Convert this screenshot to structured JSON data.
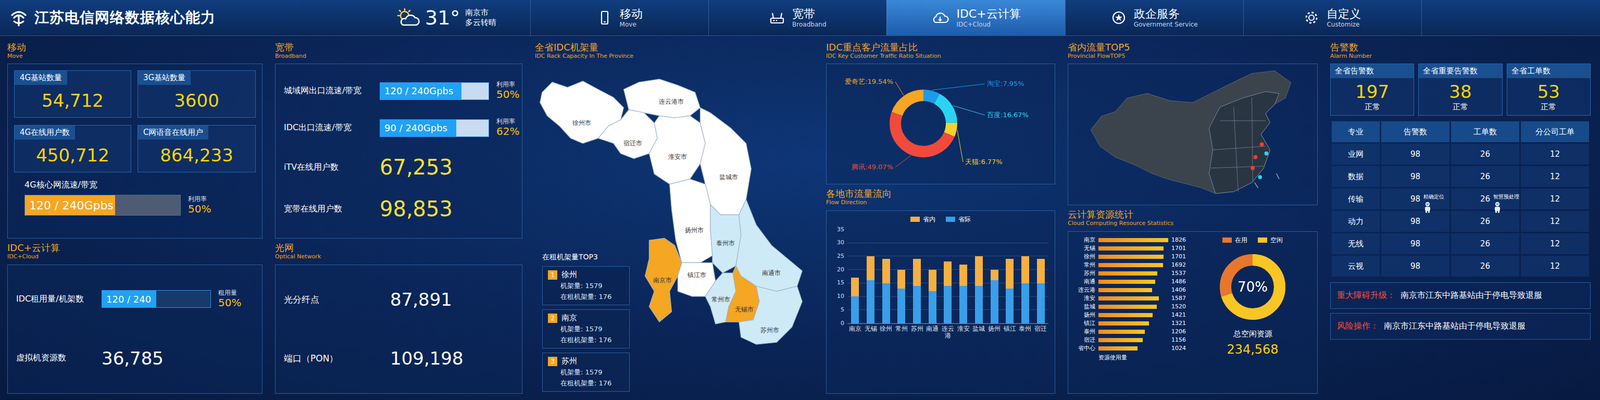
{
  "header": {
    "title": "江苏电信网络数据核心能力",
    "weather": {
      "temp": "31°",
      "city": "南京市",
      "desc": "多云转晴"
    }
  },
  "tabs": [
    {
      "label": "移动",
      "sub": "Move",
      "kind": "mobile",
      "selected": false
    },
    {
      "label": "宽带",
      "sub": "Broadband",
      "kind": "router",
      "selected": false
    },
    {
      "label": "IDC+云计算",
      "sub": "IDC+Cloud",
      "kind": "cloud",
      "selected": true
    },
    {
      "label": "政企服务",
      "sub": "Government Service",
      "kind": "badge",
      "selected": false
    },
    {
      "label": "自定义",
      "sub": "Customize",
      "kind": "gear",
      "selected": false
    }
  ],
  "mobile": {
    "title": "移动",
    "subtitle": "Move",
    "stats": [
      {
        "label": "4G基站数量",
        "value": "54,712"
      },
      {
        "label": "3G基站数量",
        "value": "3600"
      },
      {
        "label": "4G在线用户数",
        "value": "450,712"
      },
      {
        "label": "C网语音在线用户",
        "value": "864,233"
      }
    ],
    "bandwidth": {
      "label": "4G核心网流速/带宽",
      "reading": "120 / 240Gpbs",
      "level": 0.58,
      "rate_label": "利用率",
      "rate": "50%"
    }
  },
  "idc": {
    "title": "IDC+云计算",
    "subtitle": "IDC+Cloud",
    "usage": {
      "label": "IDC租用量/机架数",
      "reading": "120 / 240",
      "level": 0.5,
      "rate_label": "租用量",
      "rate": "50%"
    },
    "vm": {
      "label": "虚拟机资源数",
      "value": "36,785"
    }
  },
  "broadband": {
    "title": "宽带",
    "subtitle": "Broadband",
    "bars": [
      {
        "label": "城域网出口流速/带宽",
        "reading": "120 / 240Gpbs",
        "level": 0.75,
        "rate_label": "利用率",
        "rate": "50%"
      },
      {
        "label": "IDC出口流速/带宽",
        "reading": "90 / 240Gpbs",
        "level": 0.7,
        "rate_label": "利用率",
        "rate": "62%"
      }
    ],
    "stats": [
      {
        "label": "iTV在线用户数",
        "value": "67,253"
      },
      {
        "label": "宽带在线用户数",
        "value": "98,853"
      }
    ]
  },
  "optical": {
    "title": "光网",
    "subtitle": "Optical Network",
    "stats": [
      {
        "label": "光分纤点",
        "value": "87,891"
      },
      {
        "label": "端口（PON）",
        "value": "109,198"
      }
    ]
  },
  "rack": {
    "title": "全省IDC机架量",
    "subtitle": "IDC Rack Capacity In The Province",
    "cities": [
      {
        "name": "徐州市",
        "color": "#ffffff"
      },
      {
        "name": "连云港市",
        "color": "#ffffff"
      },
      {
        "name": "宿迁市",
        "color": "#ffffff"
      },
      {
        "name": "淮安市",
        "color": "#ffffff"
      },
      {
        "name": "盐城市",
        "color": "#ffffff"
      },
      {
        "name": "扬州市",
        "color": "#ffffff"
      },
      {
        "name": "泰州市",
        "color": "#cfeaf7"
      },
      {
        "name": "南通市",
        "color": "#cfeaf7"
      },
      {
        "name": "南京市",
        "color": "#f5a623"
      },
      {
        "name": "镇江市",
        "color": "#ffffff"
      },
      {
        "name": "常州市",
        "color": "#cfeaf7"
      },
      {
        "name": "无锡市",
        "color": "#f5a623"
      },
      {
        "name": "苏州市",
        "color": "#cfeaf7"
      }
    ],
    "top3": {
      "title": "在租机架量TOP3",
      "items": [
        {
          "rank": "1",
          "city": "徐州",
          "racks": "机架量: 1579",
          "rented": "在租机架量: 176"
        },
        {
          "rank": "2",
          "city": "南京",
          "racks": "机架量: 1579",
          "rented": "在租机架量: 176"
        },
        {
          "rank": "3",
          "city": "苏州",
          "racks": "机架量: 1579",
          "rented": "在租机架量: 176"
        }
      ]
    }
  },
  "customers": {
    "title": "IDC重点客户流量占比",
    "subtitle": "IDC Key Customer Traffic Ratio Situation",
    "items": [
      {
        "label": "淘宝:7.95%",
        "share": 7.95,
        "color": "#1e9be8"
      },
      {
        "label": "百度:16.67%",
        "share": 16.67,
        "color": "#2ad4f0"
      },
      {
        "label": "天猫:6.77%",
        "share": 6.77,
        "color": "#f7d12b"
      },
      {
        "label": "腾讯:49.07%",
        "share": 49.07,
        "color": "#f04a3c"
      },
      {
        "label": "爱奇艺:19.54%",
        "share": 19.54,
        "color": "#f5a623"
      }
    ]
  },
  "flow": {
    "title": "各地市流量流向",
    "subtitle": "Flow Direction",
    "y_ticks": [
      "0",
      "5",
      "10",
      "15",
      "20",
      "25",
      "30",
      "35"
    ],
    "categories": [
      "南京",
      "无锡",
      "徐州",
      "常州",
      "苏州",
      "南通",
      "连云港",
      "淮安",
      "盐城",
      "扬州",
      "镇江",
      "泰州",
      "宿迁"
    ],
    "series": [
      {
        "name": "省内",
        "color": "#f5b041",
        "values": [
          7,
          9,
          9,
          7,
          10,
          8,
          9,
          8,
          11,
          4,
          11,
          10,
          9
        ]
      },
      {
        "name": "省际",
        "color": "#3a9ee8",
        "values": [
          10,
          16,
          15,
          13,
          14,
          12,
          14,
          14,
          14,
          16,
          13,
          15,
          15
        ]
      }
    ]
  },
  "top5": {
    "title": "省内流量TOP5",
    "subtitle": "Provincial FlowTOP5",
    "markers": [
      {
        "color": "#ff3b30"
      },
      {
        "color": "#ff3b30"
      },
      {
        "color": "#2ad4f0"
      },
      {
        "color": "#ff3b30"
      },
      {
        "color": "#2ad4f0"
      }
    ]
  },
  "cloud": {
    "title": "云计算资源统计",
    "subtitle": "Cloud Computing Resource Statistics",
    "bars": [
      {
        "city": "南京",
        "value": "1826"
      },
      {
        "city": "无锡",
        "value": "1701"
      },
      {
        "city": "徐州",
        "value": "1701"
      },
      {
        "city": "常州",
        "value": "1692"
      },
      {
        "city": "苏州",
        "value": "1537"
      },
      {
        "city": "南通",
        "value": "1486"
      },
      {
        "city": "连云港",
        "value": "1406"
      },
      {
        "city": "淮安",
        "value": "1587"
      },
      {
        "city": "盐城",
        "value": "1520"
      },
      {
        "city": "扬州",
        "value": "1421"
      },
      {
        "city": "镇江",
        "value": "1321"
      },
      {
        "city": "泰州",
        "value": "1206"
      },
      {
        "city": "宿迁",
        "value": "1156"
      },
      {
        "city": "省中心",
        "value": "1024"
      }
    ],
    "caption": "资源使用量",
    "legend": [
      {
        "label": "在用",
        "color": "#e8772e"
      },
      {
        "label": "空闲",
        "color": "#f7c624"
      }
    ],
    "donut": {
      "reading": "70%",
      "level": 0.7
    },
    "idle": {
      "label": "总空闲资源",
      "value": "234,568"
    }
  },
  "alarms": {
    "title": "告警数",
    "subtitle": "Alarm Number",
    "cards": [
      {
        "label": "全省告警数",
        "value": "197",
        "status": "正常"
      },
      {
        "label": "全省重要告警数",
        "value": "38",
        "status": "正常"
      },
      {
        "label": "全省工单数",
        "value": "53",
        "status": "正常"
      }
    ],
    "table": {
      "columns": [
        "专业",
        "告警数",
        "工单数",
        "分公司工单"
      ],
      "rows": [
        [
          "业网",
          "98",
          "26",
          "12"
        ],
        [
          "数据",
          "98",
          "26",
          "12"
        ],
        [
          "传输",
          "98",
          "26",
          "12"
        ],
        [
          "动力",
          "98",
          "26",
          "12"
        ],
        [
          "无线",
          "98",
          "26",
          "12"
        ],
        [
          "云视",
          "98",
          "26",
          "12"
        ]
      ]
    },
    "assistants": [
      {
        "label": "精确定位"
      },
      {
        "label": "智慧预处理"
      }
    ],
    "notices": [
      {
        "label": "重大障碍升级：",
        "text": "南京市江东中路基站由于停电导致退服"
      },
      {
        "label": "风险操作：",
        "text": "南京市江东中路基站由于停电导致退服"
      }
    ]
  }
}
